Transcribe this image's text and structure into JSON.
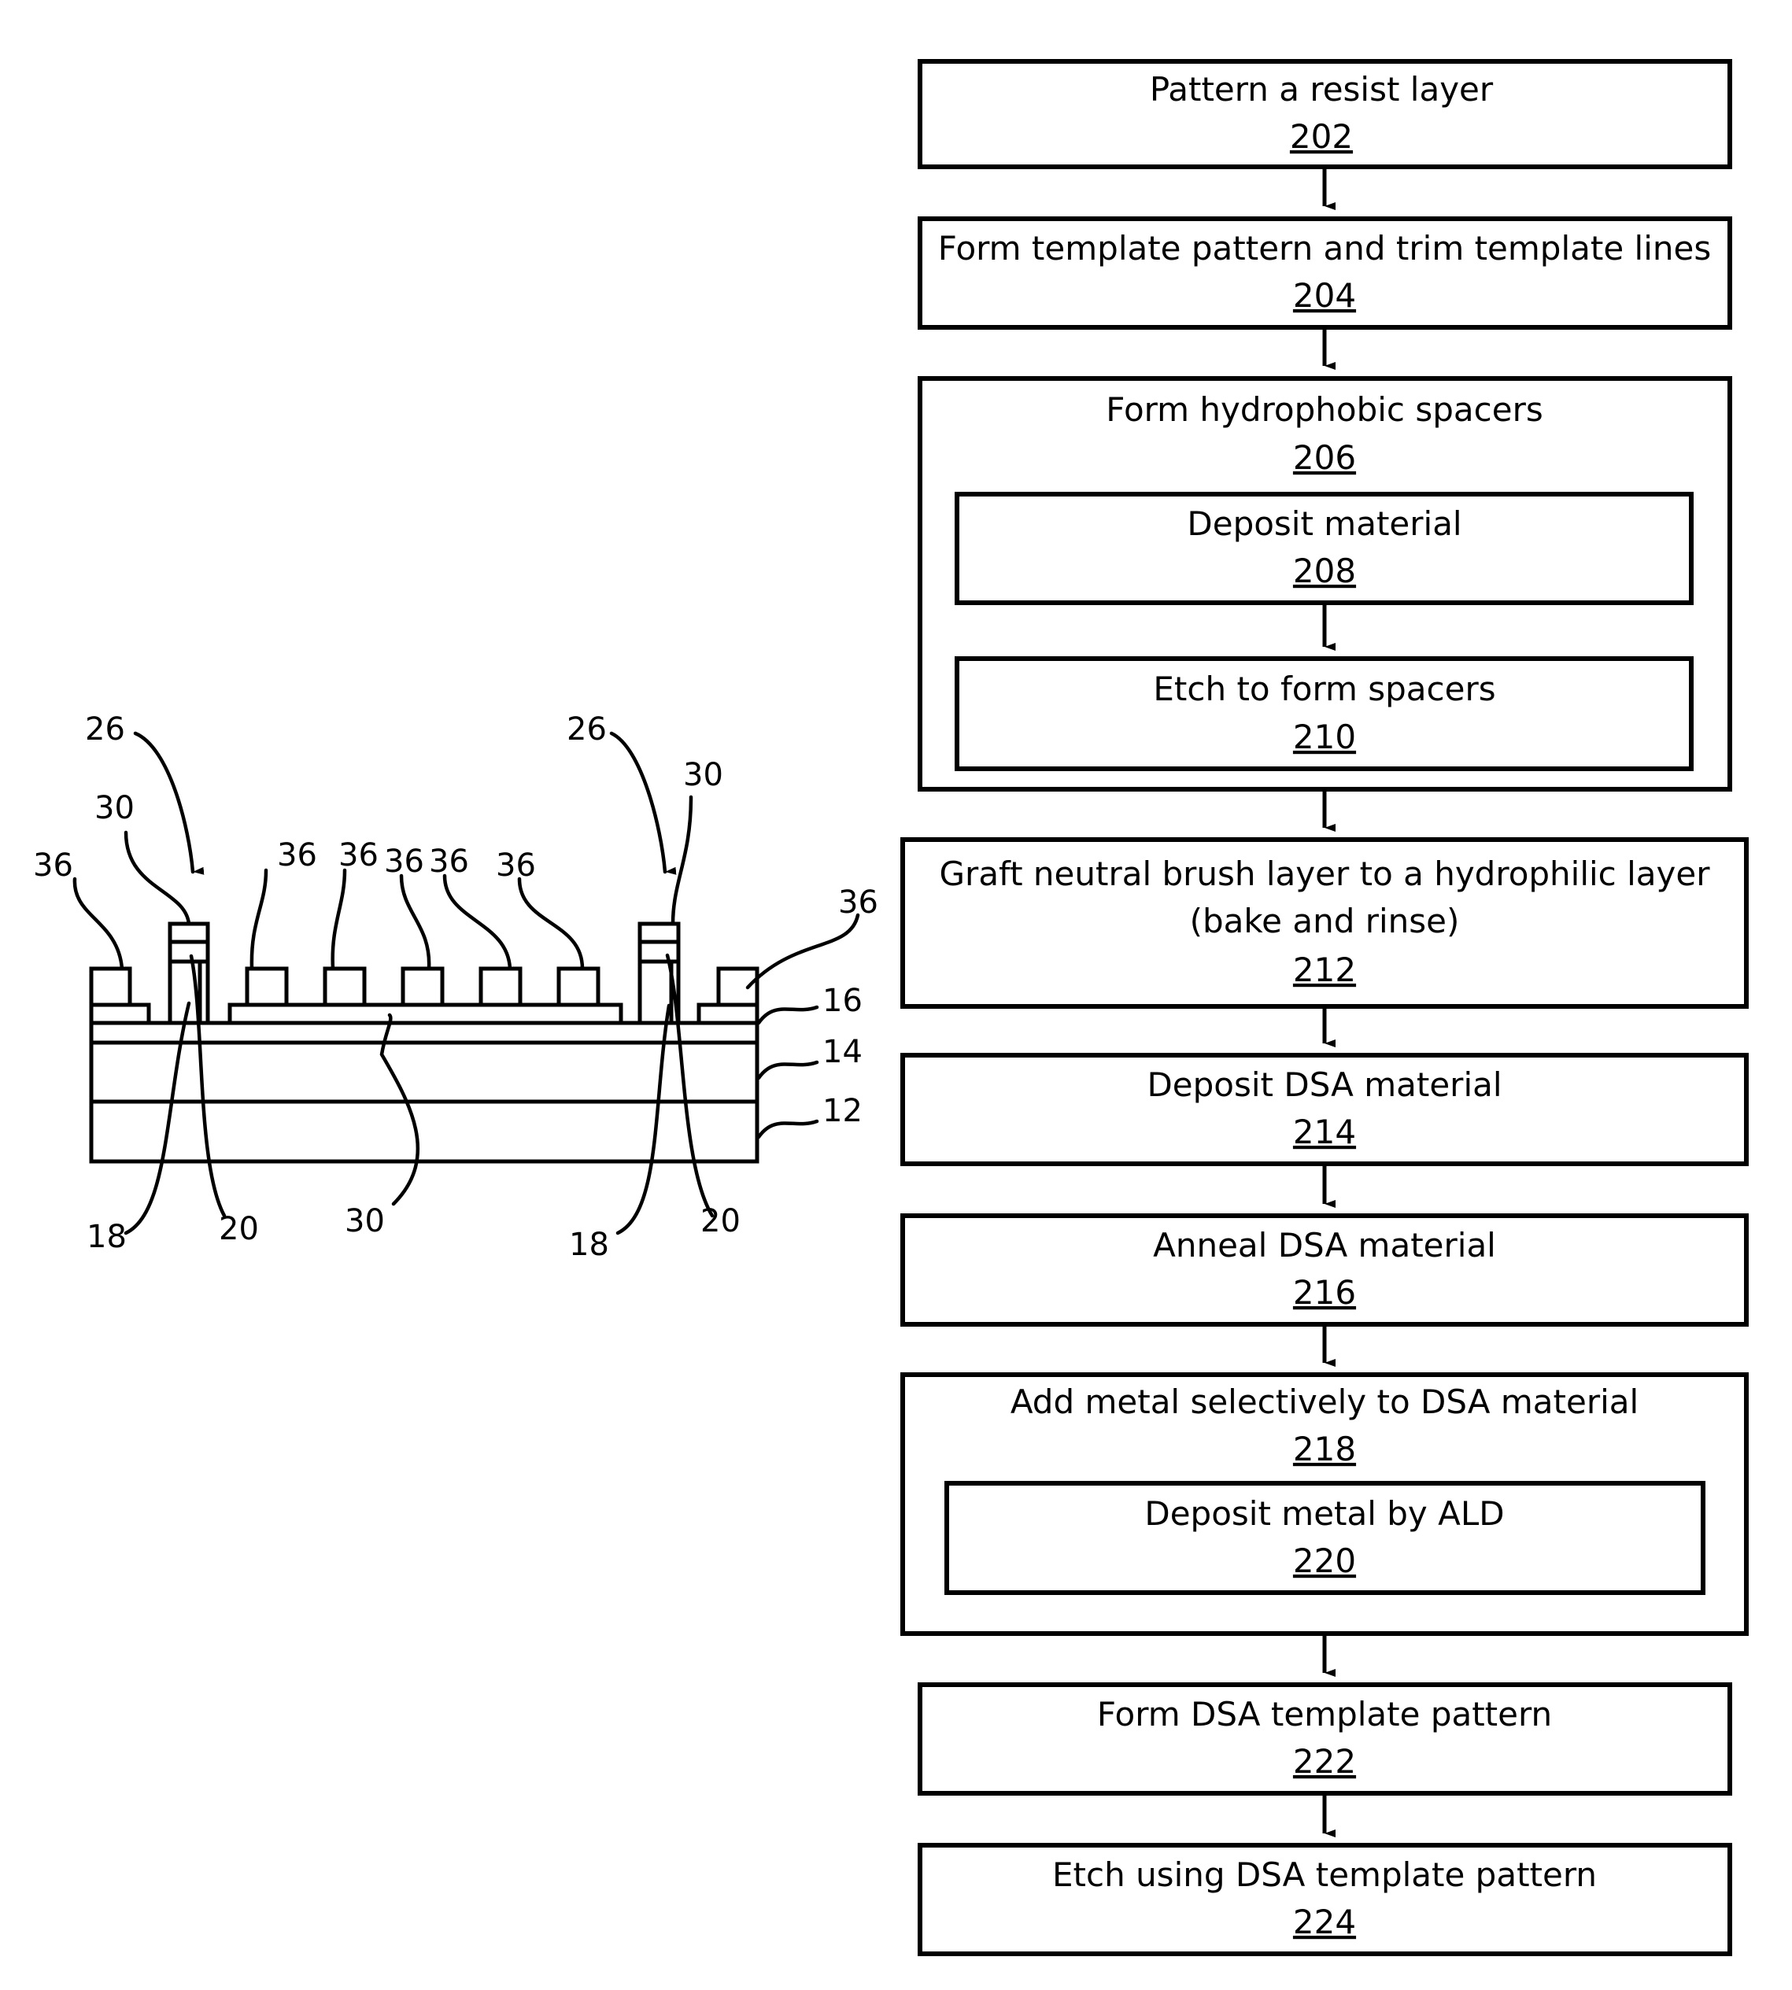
{
  "flowchart": {
    "steps": [
      {
        "id": "202",
        "lines": [
          "Pattern a resist layer"
        ]
      },
      {
        "id": "204",
        "lines": [
          "Form template pattern and trim template lines"
        ]
      },
      {
        "id": "206",
        "lines": [
          "Form hydrophobic spacers"
        ],
        "substeps": [
          {
            "id": "208",
            "lines": [
              "Deposit material"
            ]
          },
          {
            "id": "210",
            "lines": [
              "Etch to form spacers"
            ]
          }
        ]
      },
      {
        "id": "212",
        "lines": [
          "Graft neutral brush layer to a hydrophilic layer",
          "(bake and rinse)"
        ]
      },
      {
        "id": "214",
        "lines": [
          "Deposit DSA material"
        ]
      },
      {
        "id": "216",
        "lines": [
          "Anneal DSA material"
        ]
      },
      {
        "id": "218",
        "lines": [
          "Add metal selectively to DSA material"
        ],
        "substeps": [
          {
            "id": "220",
            "lines": [
              "Deposit metal by ALD"
            ]
          }
        ]
      },
      {
        "id": "222",
        "lines": [
          "Form DSA template pattern"
        ]
      },
      {
        "id": "224",
        "lines": [
          "Etch using DSA template pattern"
        ]
      }
    ]
  },
  "cross_section": {
    "layer_labels": [
      "16",
      "14",
      "12"
    ],
    "top_labels": {
      "left_36": "36",
      "left_30": "30",
      "left_26": "26",
      "mid_36_a": "36",
      "mid_36_b": "36",
      "mid_36_c": "36",
      "mid_36_d": "36",
      "mid_36_e": "36",
      "right_26": "26",
      "right_30": "30",
      "right_36": "36"
    },
    "bottom_labels": {
      "left_18": "18",
      "left_20": "20",
      "mid_30": "30",
      "right_18": "18",
      "right_20": "20"
    }
  }
}
